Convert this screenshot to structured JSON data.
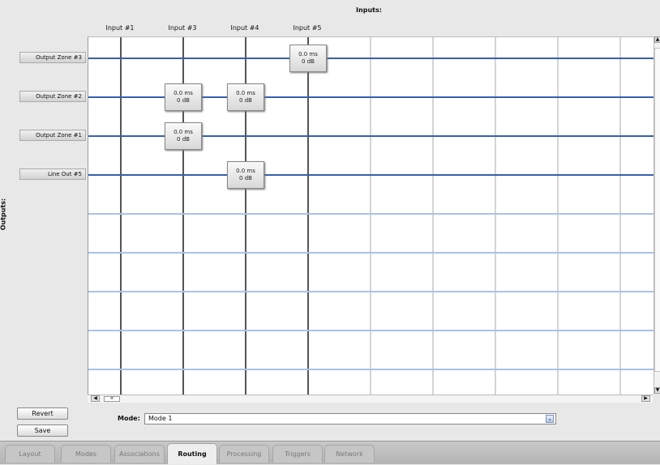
{
  "inputs": {
    "title": "Inputs:",
    "columns": [
      {
        "label": "Input #1",
        "active": true
      },
      {
        "label": "Input #3",
        "active": true
      },
      {
        "label": "Input #4",
        "active": true
      },
      {
        "label": "Input #5",
        "active": true
      },
      {
        "label": "",
        "active": false
      },
      {
        "label": "",
        "active": false
      },
      {
        "label": "",
        "active": false
      },
      {
        "label": "",
        "active": false
      },
      {
        "label": "",
        "active": false
      }
    ]
  },
  "outputs": {
    "title": "Outputs:",
    "rows": [
      {
        "label": "Output Zone #3",
        "active": true
      },
      {
        "label": "Output Zone #2",
        "active": true
      },
      {
        "label": "Output Zone #1",
        "active": true
      },
      {
        "label": "Line Out #5",
        "active": true
      },
      {
        "label": "",
        "active": false
      },
      {
        "label": "",
        "active": false
      },
      {
        "label": "",
        "active": false
      },
      {
        "label": "",
        "active": false
      },
      {
        "label": "",
        "active": false
      }
    ]
  },
  "routes": [
    {
      "row": 0,
      "col": 3,
      "delay": "0.0 ms",
      "gain": "0 dB"
    },
    {
      "row": 1,
      "col": 1,
      "delay": "0.0 ms",
      "gain": "0 dB"
    },
    {
      "row": 1,
      "col": 2,
      "delay": "0.0 ms",
      "gain": "0 dB"
    },
    {
      "row": 2,
      "col": 1,
      "delay": "0.0 ms",
      "gain": "0 dB"
    },
    {
      "row": 3,
      "col": 2,
      "delay": "0.0 ms",
      "gain": "0 dB"
    }
  ],
  "buttons": {
    "revert": "Revert",
    "save": "Save"
  },
  "mode": {
    "label": "Mode:",
    "value": "Mode 1"
  },
  "tabs": [
    {
      "label": "Layout",
      "active": false
    },
    {
      "label": "Modes",
      "active": false
    },
    {
      "label": "Associations",
      "active": false
    },
    {
      "label": "Routing",
      "active": true
    },
    {
      "label": "Processing",
      "active": false
    },
    {
      "label": "Triggers",
      "active": false
    },
    {
      "label": "Network",
      "active": false
    }
  ],
  "colors": {
    "active_row": "#3560ad",
    "inactive_row": "#a9c3ea",
    "active_col": "#555555",
    "inactive_col": "#d4d4d4"
  }
}
